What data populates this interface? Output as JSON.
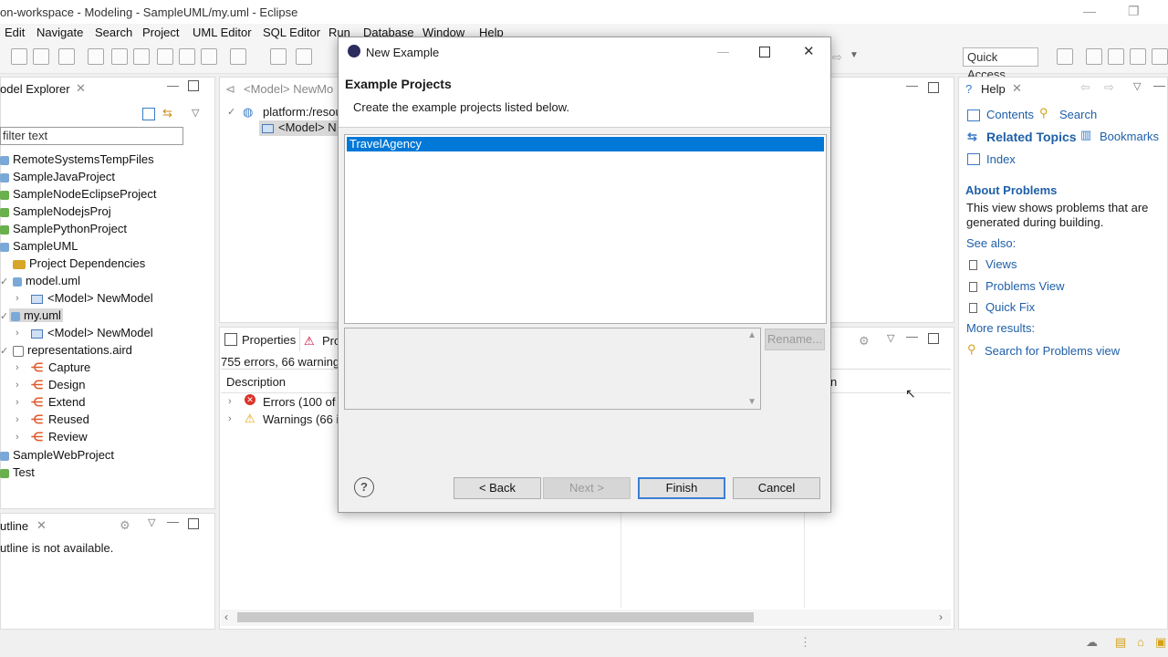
{
  "window": {
    "title": "on-workspace - Modeling - SampleUML/my.uml - Eclipse"
  },
  "menu": [
    "Edit",
    "Navigate",
    "Search",
    "Project",
    "UML Editor",
    "SQL Editor",
    "Run",
    "Database",
    "Window",
    "Help"
  ],
  "toolbar": {
    "quick_access": "Quick Access"
  },
  "model_explorer": {
    "title": "odel Explorer",
    "filter_placeholder": "filter text",
    "items": [
      {
        "label": "RemoteSystemsTempFiles"
      },
      {
        "label": "SampleJavaProject"
      },
      {
        "label": "SampleNodeEclipseProject"
      },
      {
        "label": "SampleNodejsProj"
      },
      {
        "label": "SamplePythonProject"
      },
      {
        "label": "SampleUML"
      },
      {
        "label": "Project Dependencies"
      },
      {
        "label": "model.uml"
      },
      {
        "label": "<Model> NewModel"
      },
      {
        "label": "my.uml"
      },
      {
        "label": "<Model> NewModel"
      },
      {
        "label": "representations.aird"
      },
      {
        "label": "Capture"
      },
      {
        "label": "Design"
      },
      {
        "label": "Extend"
      },
      {
        "label": "Reused"
      },
      {
        "label": "Review"
      },
      {
        "label": "SampleWebProject"
      },
      {
        "label": "Test"
      }
    ]
  },
  "outline": {
    "title": "utline",
    "message": "utline is not available."
  },
  "editor": {
    "tab": "<Model> NewMo",
    "tree": [
      "platform:/resou",
      "<Model> N"
    ]
  },
  "problems": {
    "tab_properties": "Properties",
    "tab_problems": "Pro",
    "summary": "755 errors, 66 warnings,",
    "column_description": "Description",
    "column_right": "n",
    "rows": [
      "Errors (100 of 7",
      "Warnings (66 it"
    ]
  },
  "help": {
    "title": "Help",
    "contents": "Contents",
    "search": "Search",
    "related_topics": "Related Topics",
    "bookmarks": "Bookmarks",
    "index": "Index",
    "about_heading": "About Problems",
    "about_text_1": "This view shows problems that are",
    "about_text_2": "generated during building.",
    "see_also": "See also:",
    "links": [
      "Views",
      "Problems View",
      "Quick Fix"
    ],
    "more_results": "More results:",
    "search_link": "Search for Problems view"
  },
  "dialog": {
    "title": "New Example",
    "heading": "Example Projects",
    "description": "Create the example projects listed below.",
    "projects": [
      "TravelAgency"
    ],
    "rename": "Rename...",
    "back": "< Back",
    "next": "Next >",
    "finish": "Finish",
    "cancel": "Cancel",
    "help_glyph": "?"
  },
  "colors": {
    "selection": "#0078d7",
    "link": "#1f5fa8",
    "heading": "#1f5fa8"
  }
}
